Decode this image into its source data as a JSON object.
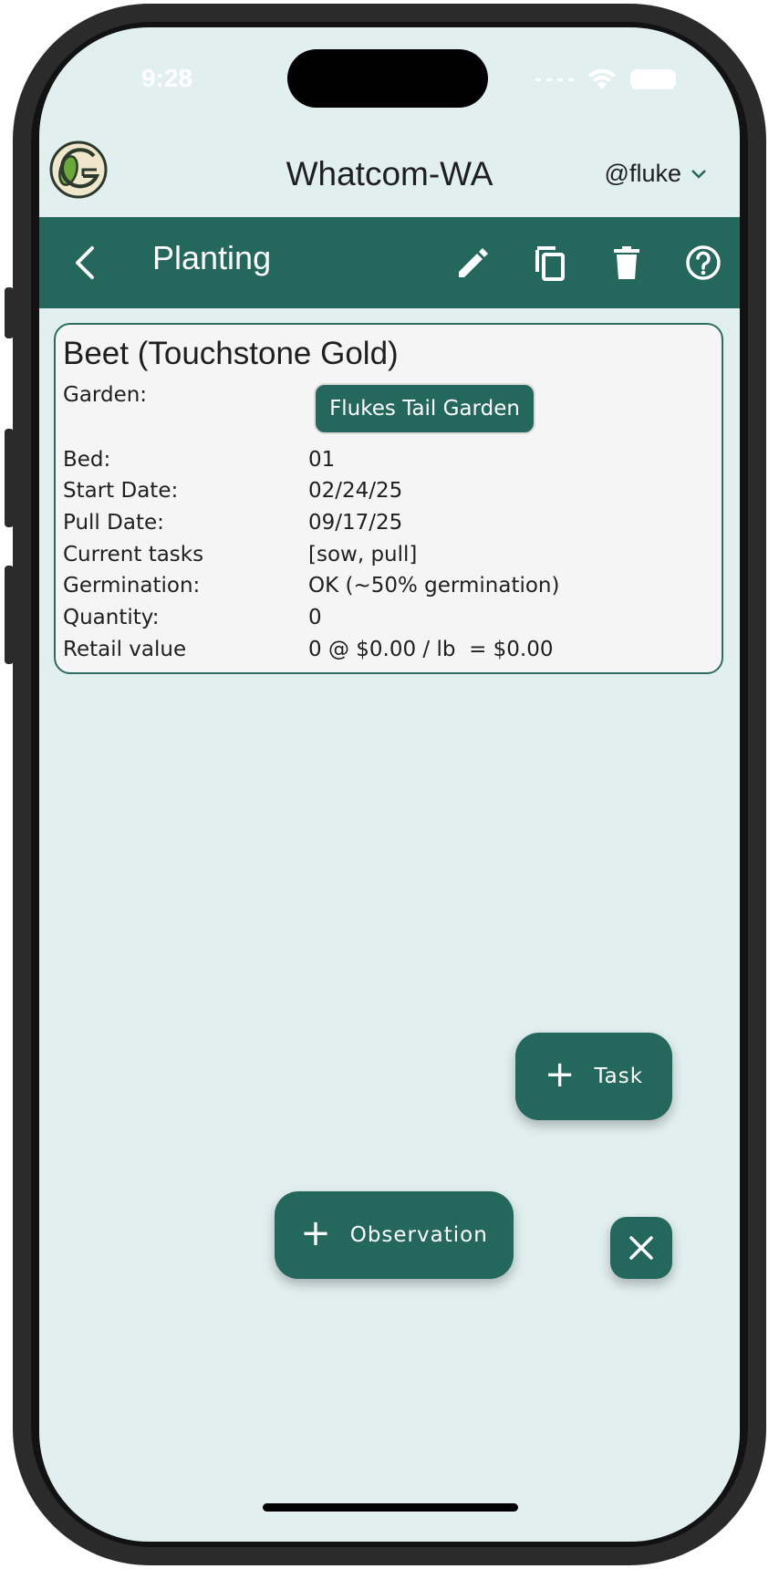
{
  "status_bar": {
    "time": "9:28"
  },
  "header": {
    "title": "Whatcom-WA",
    "user": "@fluke",
    "user_menu_icon": "chevron-down-icon"
  },
  "appbar": {
    "title": "Planting",
    "back_icon": "back-arrow-icon",
    "actions": [
      "edit-icon",
      "copy-icon",
      "delete-icon",
      "help-icon"
    ]
  },
  "planting": {
    "title": "Beet (Touchstone Gold)",
    "garden_label": "Garden:",
    "garden_value": "Flukes Tail Garden",
    "rows": [
      {
        "label": "Bed:",
        "value": "01"
      },
      {
        "label": "Start Date:",
        "value": "02/24/25"
      },
      {
        "label": "Pull Date:",
        "value": "09/17/25"
      },
      {
        "label": "Current tasks",
        "value": "[sow, pull]"
      },
      {
        "label": "Germination:",
        "value": "OK (~50% germination)"
      },
      {
        "label": "Quantity:",
        "value": "0"
      },
      {
        "label": "Retail value",
        "value": "0 @ $0.00 / lb  = $0.00"
      }
    ]
  },
  "fab": {
    "task_label": "Task",
    "observation_label": "Observation",
    "close_icon": "close-icon"
  },
  "colors": {
    "primary": "#24675d",
    "background": "#e1efef",
    "card": "#f5f5f5"
  }
}
